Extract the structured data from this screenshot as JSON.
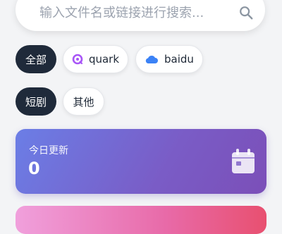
{
  "search": {
    "placeholder": "输入文件名或链接进行搜索..."
  },
  "filters": {
    "source": [
      {
        "label": "全部",
        "active": true
      },
      {
        "label": "quark",
        "icon": "quark-icon",
        "icon_color": "#a855f7",
        "active": false
      },
      {
        "label": "baidu",
        "icon": "cloud-icon",
        "icon_color": "#3b82f6",
        "active": false
      }
    ],
    "category": [
      {
        "label": "短剧",
        "active": true
      },
      {
        "label": "其他",
        "active": false
      }
    ]
  },
  "stats": {
    "today_updated": {
      "label": "今日更新",
      "value": "0",
      "icon": "calendar-icon"
    }
  },
  "colors": {
    "active_chip": "#1f2a3a",
    "stat_card_gradient": [
      "#6b7ee6",
      "#7b4fb8"
    ],
    "next_card_gradient": [
      "#f0a0dc",
      "#e85070"
    ]
  }
}
